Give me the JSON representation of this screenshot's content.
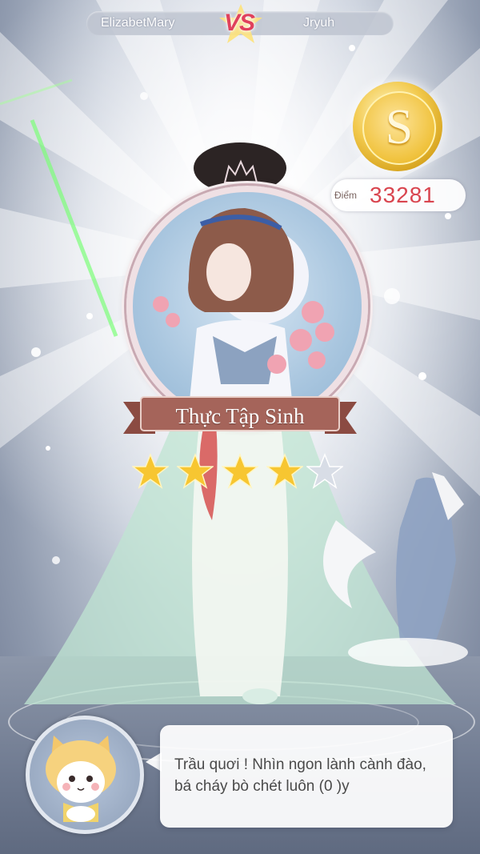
{
  "versus": {
    "player_left": "ElizabetMary",
    "vs_label": "VS",
    "player_right": "Jryuh"
  },
  "rank": {
    "letter": "S",
    "color": "#f2c94c"
  },
  "score": {
    "label": "Điểm",
    "value": "33281",
    "color": "#d9454f"
  },
  "outfit": {
    "title": "Thực Tập Sinh",
    "stars_filled": 4,
    "stars_total": 5
  },
  "dialog": {
    "avatar_icon": "cat-mascot-icon",
    "text": "Trầu quơi ! Nhìn ngon lành cành đào, bá cháy bò chét luôn (0 )y"
  },
  "colors": {
    "accent_pink": "#e0415c",
    "ribbon": "#a5645a",
    "star": "#f7c631",
    "star_empty": "#d8dde6"
  }
}
